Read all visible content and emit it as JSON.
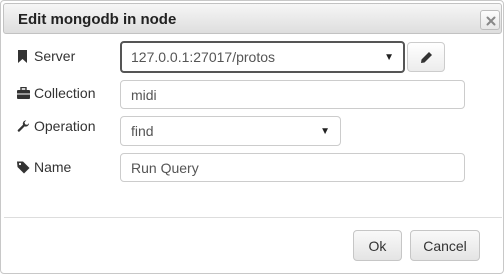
{
  "dialog": {
    "title": "Edit mongodb in node"
  },
  "form": {
    "server": {
      "label": "Server",
      "value": "127.0.0.1:27017/protos",
      "icon": "bookmark-icon"
    },
    "collection": {
      "label": "Collection",
      "value": "midi",
      "icon": "briefcase-icon"
    },
    "operation": {
      "label": "Operation",
      "value": "find",
      "icon": "wrench-icon"
    },
    "name": {
      "label": "Name",
      "value": "Run Query",
      "icon": "tag-icon"
    }
  },
  "buttons": {
    "ok": "Ok",
    "cancel": "Cancel"
  },
  "colors": {
    "titlebar": "#e6e6e6",
    "border": "#cccccc",
    "text": "#333333"
  }
}
